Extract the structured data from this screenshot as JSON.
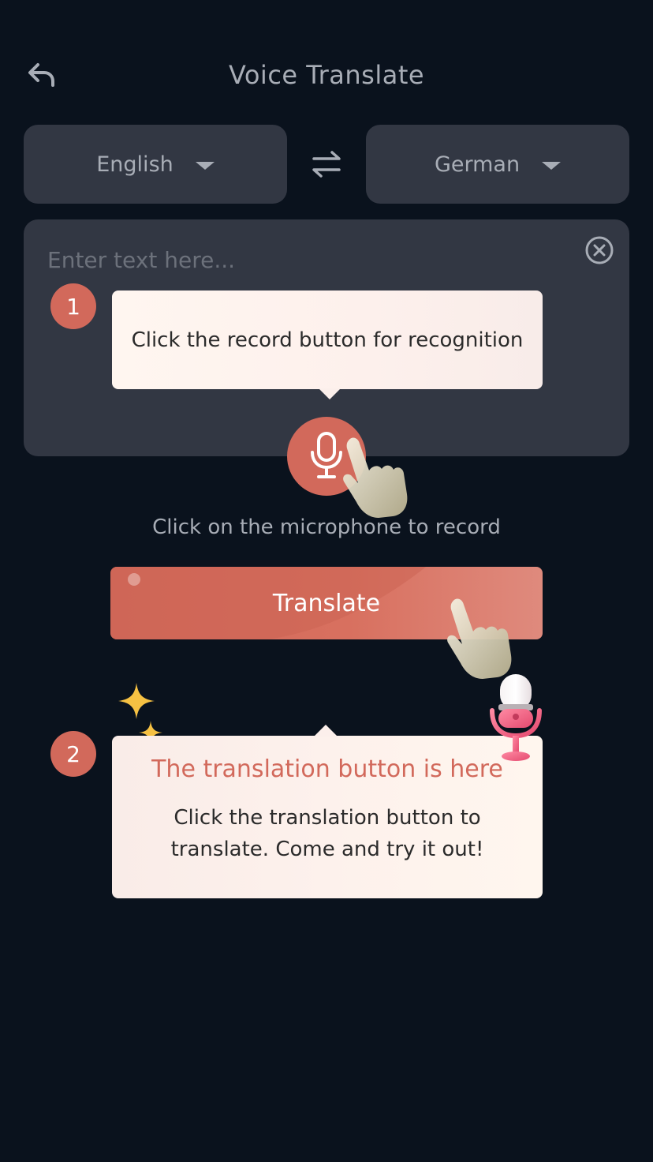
{
  "header": {
    "title": "Voice Translate",
    "back_icon": "back-arrow-icon"
  },
  "languages": {
    "source": "English",
    "target": "German",
    "swap_icon": "swap-arrows-icon"
  },
  "input": {
    "placeholder": "Enter text here...",
    "value": "",
    "clear_icon": "clear-circle-icon"
  },
  "guide": {
    "step1": {
      "number": "1",
      "text": "Click the record button for recognition"
    },
    "step2": {
      "number": "2",
      "title": "The translation button is here",
      "body": "Click the translation button to translate. Come and try it out!"
    }
  },
  "record": {
    "icon": "microphone-icon",
    "hint": "Click on the microphone to record"
  },
  "actions": {
    "translate_label": "Translate"
  },
  "colors": {
    "background": "#0a121d",
    "panel": "#323743",
    "accent": "#d2695b",
    "muted_text": "#a8adb6",
    "tooltip_bg": "#fdf1ec"
  }
}
